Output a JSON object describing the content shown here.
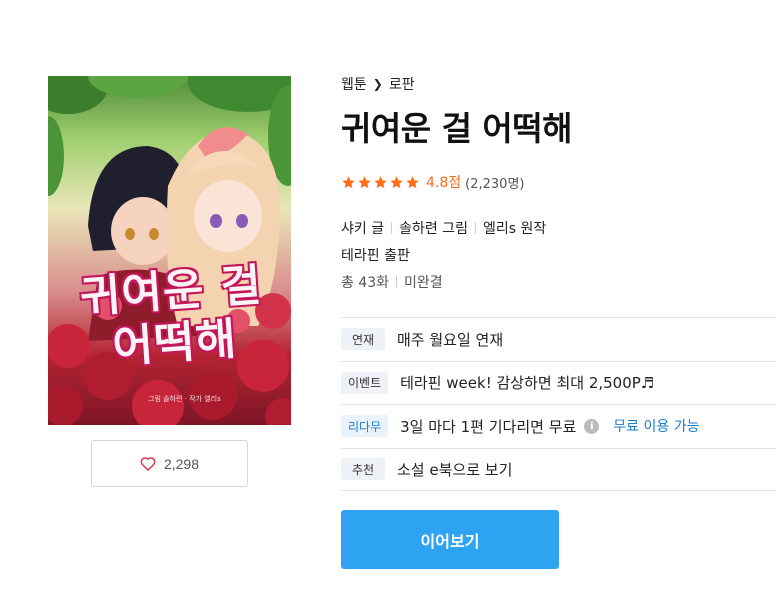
{
  "cover": {
    "title_line1": "귀여운 걸",
    "title_line2": "어떡해",
    "credit": "그림 솔하련 · 작가 엘리s"
  },
  "like": {
    "count": "2,298",
    "icon": "heart-outline-icon"
  },
  "breadcrumb": {
    "category": "웹툰",
    "genre": "로판"
  },
  "title": "귀여운 걸 어떡해",
  "rating": {
    "stars": 5,
    "score": "4.8점",
    "count": "(2,230명)",
    "star_color": "#ff6b1a"
  },
  "creators": {
    "writer": "샤키 글",
    "artist": "솔하련 그림",
    "original": "엘리s 원작"
  },
  "publisher": "테라핀 출판",
  "episodes": {
    "total": "총 43화",
    "status": "미완결"
  },
  "rows": [
    {
      "tag": "연재",
      "text": "매주 월요일 연재"
    },
    {
      "tag": "이벤트",
      "text": "테라핀 week! 감상하면 최대 2,500P♬"
    },
    {
      "tag": "리다무",
      "text": "3일 마다 1편 기다리면 무료",
      "link": "무료 이용 가능"
    },
    {
      "tag": "추천",
      "text": "소설 e북으로 보기"
    }
  ],
  "continue_button": "이어보기",
  "colors": {
    "accent_blue": "#2ea3f2",
    "link_blue": "#1a7ccf",
    "star_orange": "#ff6b1a"
  }
}
